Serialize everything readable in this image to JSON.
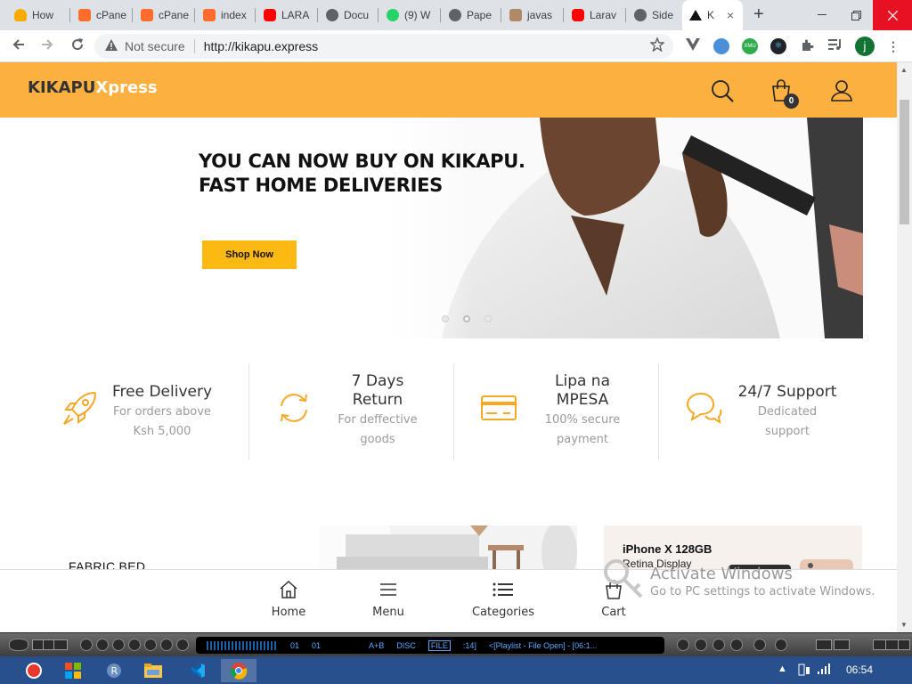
{
  "browser": {
    "tabs": [
      {
        "label": "How",
        "favicon_color": "#f9ab00"
      },
      {
        "label": "cPane",
        "favicon_color": "#ff6c2c"
      },
      {
        "label": "cPane",
        "favicon_color": "#ff6c2c"
      },
      {
        "label": "index",
        "favicon_color": "#ff6c2c"
      },
      {
        "label": "LARA",
        "favicon_color": "#ff0000"
      },
      {
        "label": "Docu",
        "favicon_color": "#5f6368"
      },
      {
        "label": "(9) W",
        "favicon_color": "#25d366"
      },
      {
        "label": "Pape",
        "favicon_color": "#5f6368"
      },
      {
        "label": "javas",
        "favicon_color": "#b08968"
      },
      {
        "label": "Larav",
        "favicon_color": "#ff0000"
      },
      {
        "label": "Side",
        "favicon_color": "#5f6368"
      },
      {
        "label": "K",
        "favicon_color": "#111111"
      }
    ],
    "active_tab_close": "×",
    "new_tab": "+",
    "security_label": "Not secure",
    "url": "http://kikapu.express",
    "profile_initial": "j"
  },
  "site": {
    "logo_main": "KIKAPU",
    "logo_accent": "Xpress",
    "cart_count": "0",
    "hero": {
      "line1": "YOU CAN NOW BUY ON KIKAPU.",
      "line2": "FAST HOME DELIVERIES",
      "cta": "Shop Now",
      "slide_count": 3,
      "active_slide": 2
    },
    "features": [
      {
        "title": "Free Delivery",
        "sub1": "For orders above",
        "sub2": "Ksh 5,000",
        "icon": "rocket-icon"
      },
      {
        "title": "7 Days",
        "title2": "Return",
        "sub1": "For deffective",
        "sub2": "goods",
        "icon": "refresh-icon"
      },
      {
        "title": "Lipa na",
        "title2": "MPESA",
        "sub1": "100% secure",
        "sub2": "payment",
        "icon": "credit-card-icon"
      },
      {
        "title": "24/7 Support",
        "sub1": "Dedicated",
        "sub2": "support",
        "icon": "chat-icon"
      }
    ],
    "tiles": {
      "left_label": "FABRIC BED",
      "right_title": "iPhone X 128GB",
      "right_sub": "Retina Display"
    },
    "bottom_nav": [
      "Home",
      "Menu",
      "Categories",
      "Cart"
    ]
  },
  "watermark": {
    "line1": "Activate Windows",
    "line2": "Go to PC settings to activate Windows."
  },
  "media_player": {
    "time1": "01",
    "time2": "01",
    "ab": "A+B",
    "disc": "DISC",
    "file": "FILE",
    "pos": ":14]",
    "playlist": "<[Playlist - File Open] - [06:1..."
  },
  "taskbar": {
    "clock": "06:54"
  },
  "colors": {
    "brand_orange": "#fbb040",
    "cta_yellow": "#fdb913",
    "icon_orange": "#f7a823"
  }
}
